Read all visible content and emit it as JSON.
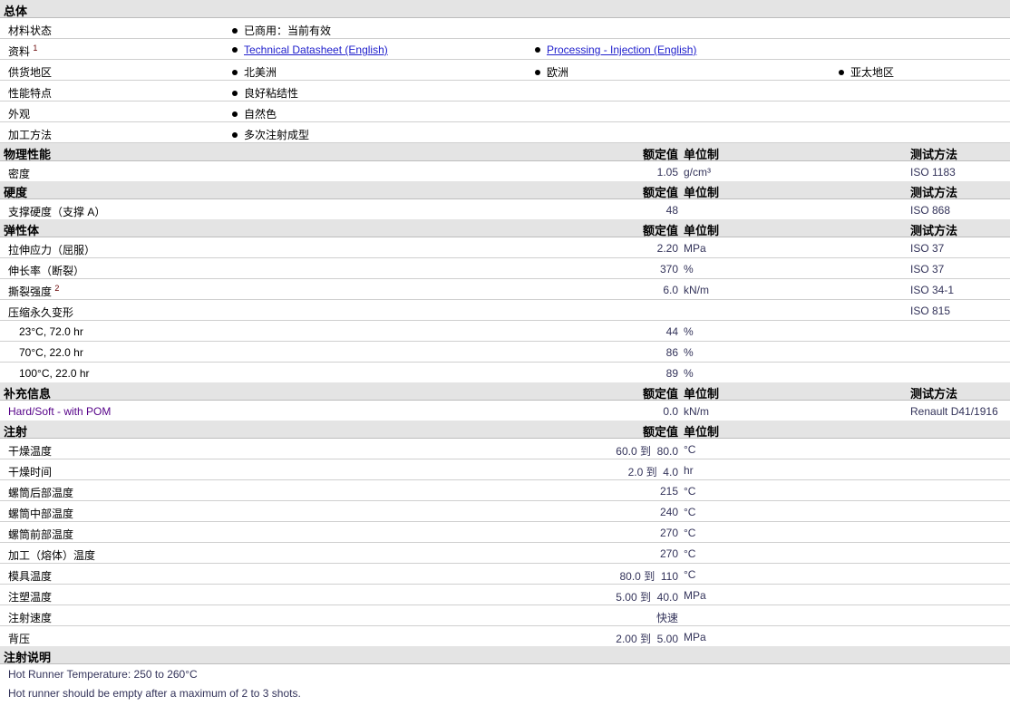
{
  "general": {
    "title": "总体",
    "rows": [
      {
        "label": "材料状态",
        "items": [
          "已商用：当前有效"
        ]
      },
      {
        "label": "资料",
        "sup": "1",
        "links": [
          "Technical Datasheet (English)",
          "Processing - Injection (English)"
        ]
      },
      {
        "label": "供货地区",
        "items": [
          "北美洲",
          "欧洲",
          "亚太地区"
        ]
      },
      {
        "label": "性能特点",
        "items": [
          "良好粘结性"
        ]
      },
      {
        "label": "外观",
        "items": [
          "自然色"
        ]
      },
      {
        "label": "加工方法",
        "items": [
          "多次注射成型"
        ]
      }
    ]
  },
  "col_headers": {
    "value": "额定值",
    "unit": "单位制",
    "method": "测试方法"
  },
  "sections": [
    {
      "title": "物理性能",
      "method_col": true,
      "rows": [
        {
          "label": "密度",
          "value": "1.05",
          "unit": "g/cm³",
          "method": "ISO 1183"
        }
      ]
    },
    {
      "title": "硬度",
      "method_col": true,
      "rows": [
        {
          "label": "支撑硬度（支撑 A）",
          "value": "48",
          "unit": "",
          "method": "ISO 868"
        }
      ]
    },
    {
      "title": "弹性体",
      "method_col": true,
      "rows": [
        {
          "label": "拉伸应力（屈服）",
          "value": "2.20",
          "unit": "MPa",
          "method": "ISO 37"
        },
        {
          "label": "伸长率（断裂）",
          "value": "370",
          "unit": "%",
          "method": "ISO 37"
        },
        {
          "label": "撕裂强度",
          "sup": "2",
          "value": "6.0",
          "unit": "kN/m",
          "method": "ISO 34-1"
        },
        {
          "label": "压缩永久变形",
          "value": "",
          "unit": "",
          "method": "ISO 815"
        },
        {
          "label": "23°C, 72.0 hr",
          "indent": true,
          "value": "44",
          "unit": "%",
          "method": ""
        },
        {
          "label": "70°C, 22.0 hr",
          "indent": true,
          "value": "86",
          "unit": "%",
          "method": ""
        },
        {
          "label": "100°C, 22.0 hr",
          "indent": true,
          "value": "89",
          "unit": "%",
          "method": ""
        }
      ]
    },
    {
      "title": "补充信息",
      "method_col": true,
      "rows": [
        {
          "label": "Hard/Soft - with POM",
          "purple": true,
          "value": "0.0",
          "unit": "kN/m",
          "method": "Renault D41/1916"
        }
      ]
    },
    {
      "title": "注射",
      "method_col": false,
      "rows": [
        {
          "label": "干燥温度",
          "value": "60.0 到  80.0",
          "unit": "°C",
          "method": ""
        },
        {
          "label": "干燥时间",
          "value": "2.0 到  4.0",
          "unit": "hr",
          "method": ""
        },
        {
          "label": "螺筒后部温度",
          "value": "215",
          "unit": "°C",
          "method": ""
        },
        {
          "label": "螺筒中部温度",
          "value": "240",
          "unit": "°C",
          "method": ""
        },
        {
          "label": "螺筒前部温度",
          "value": "270",
          "unit": "°C",
          "method": ""
        },
        {
          "label": "加工（熔体）温度",
          "value": "270",
          "unit": "°C",
          "method": ""
        },
        {
          "label": "模具温度",
          "value": "80.0 到  110",
          "unit": "°C",
          "method": ""
        },
        {
          "label": "注塑温度",
          "value": "5.00 到  40.0",
          "unit": "MPa",
          "method": ""
        },
        {
          "label": "注射速度",
          "value": "快速",
          "unit": "",
          "method": ""
        },
        {
          "label": "背压",
          "value": "2.00 到  5.00",
          "unit": "MPa",
          "method": ""
        }
      ]
    }
  ],
  "notes": {
    "title": "注射说明",
    "lines": [
      "Hot Runner Temperature: 250 to 260°C",
      "Hot runner should be empty after a maximum of 2 to 3 shots."
    ]
  }
}
